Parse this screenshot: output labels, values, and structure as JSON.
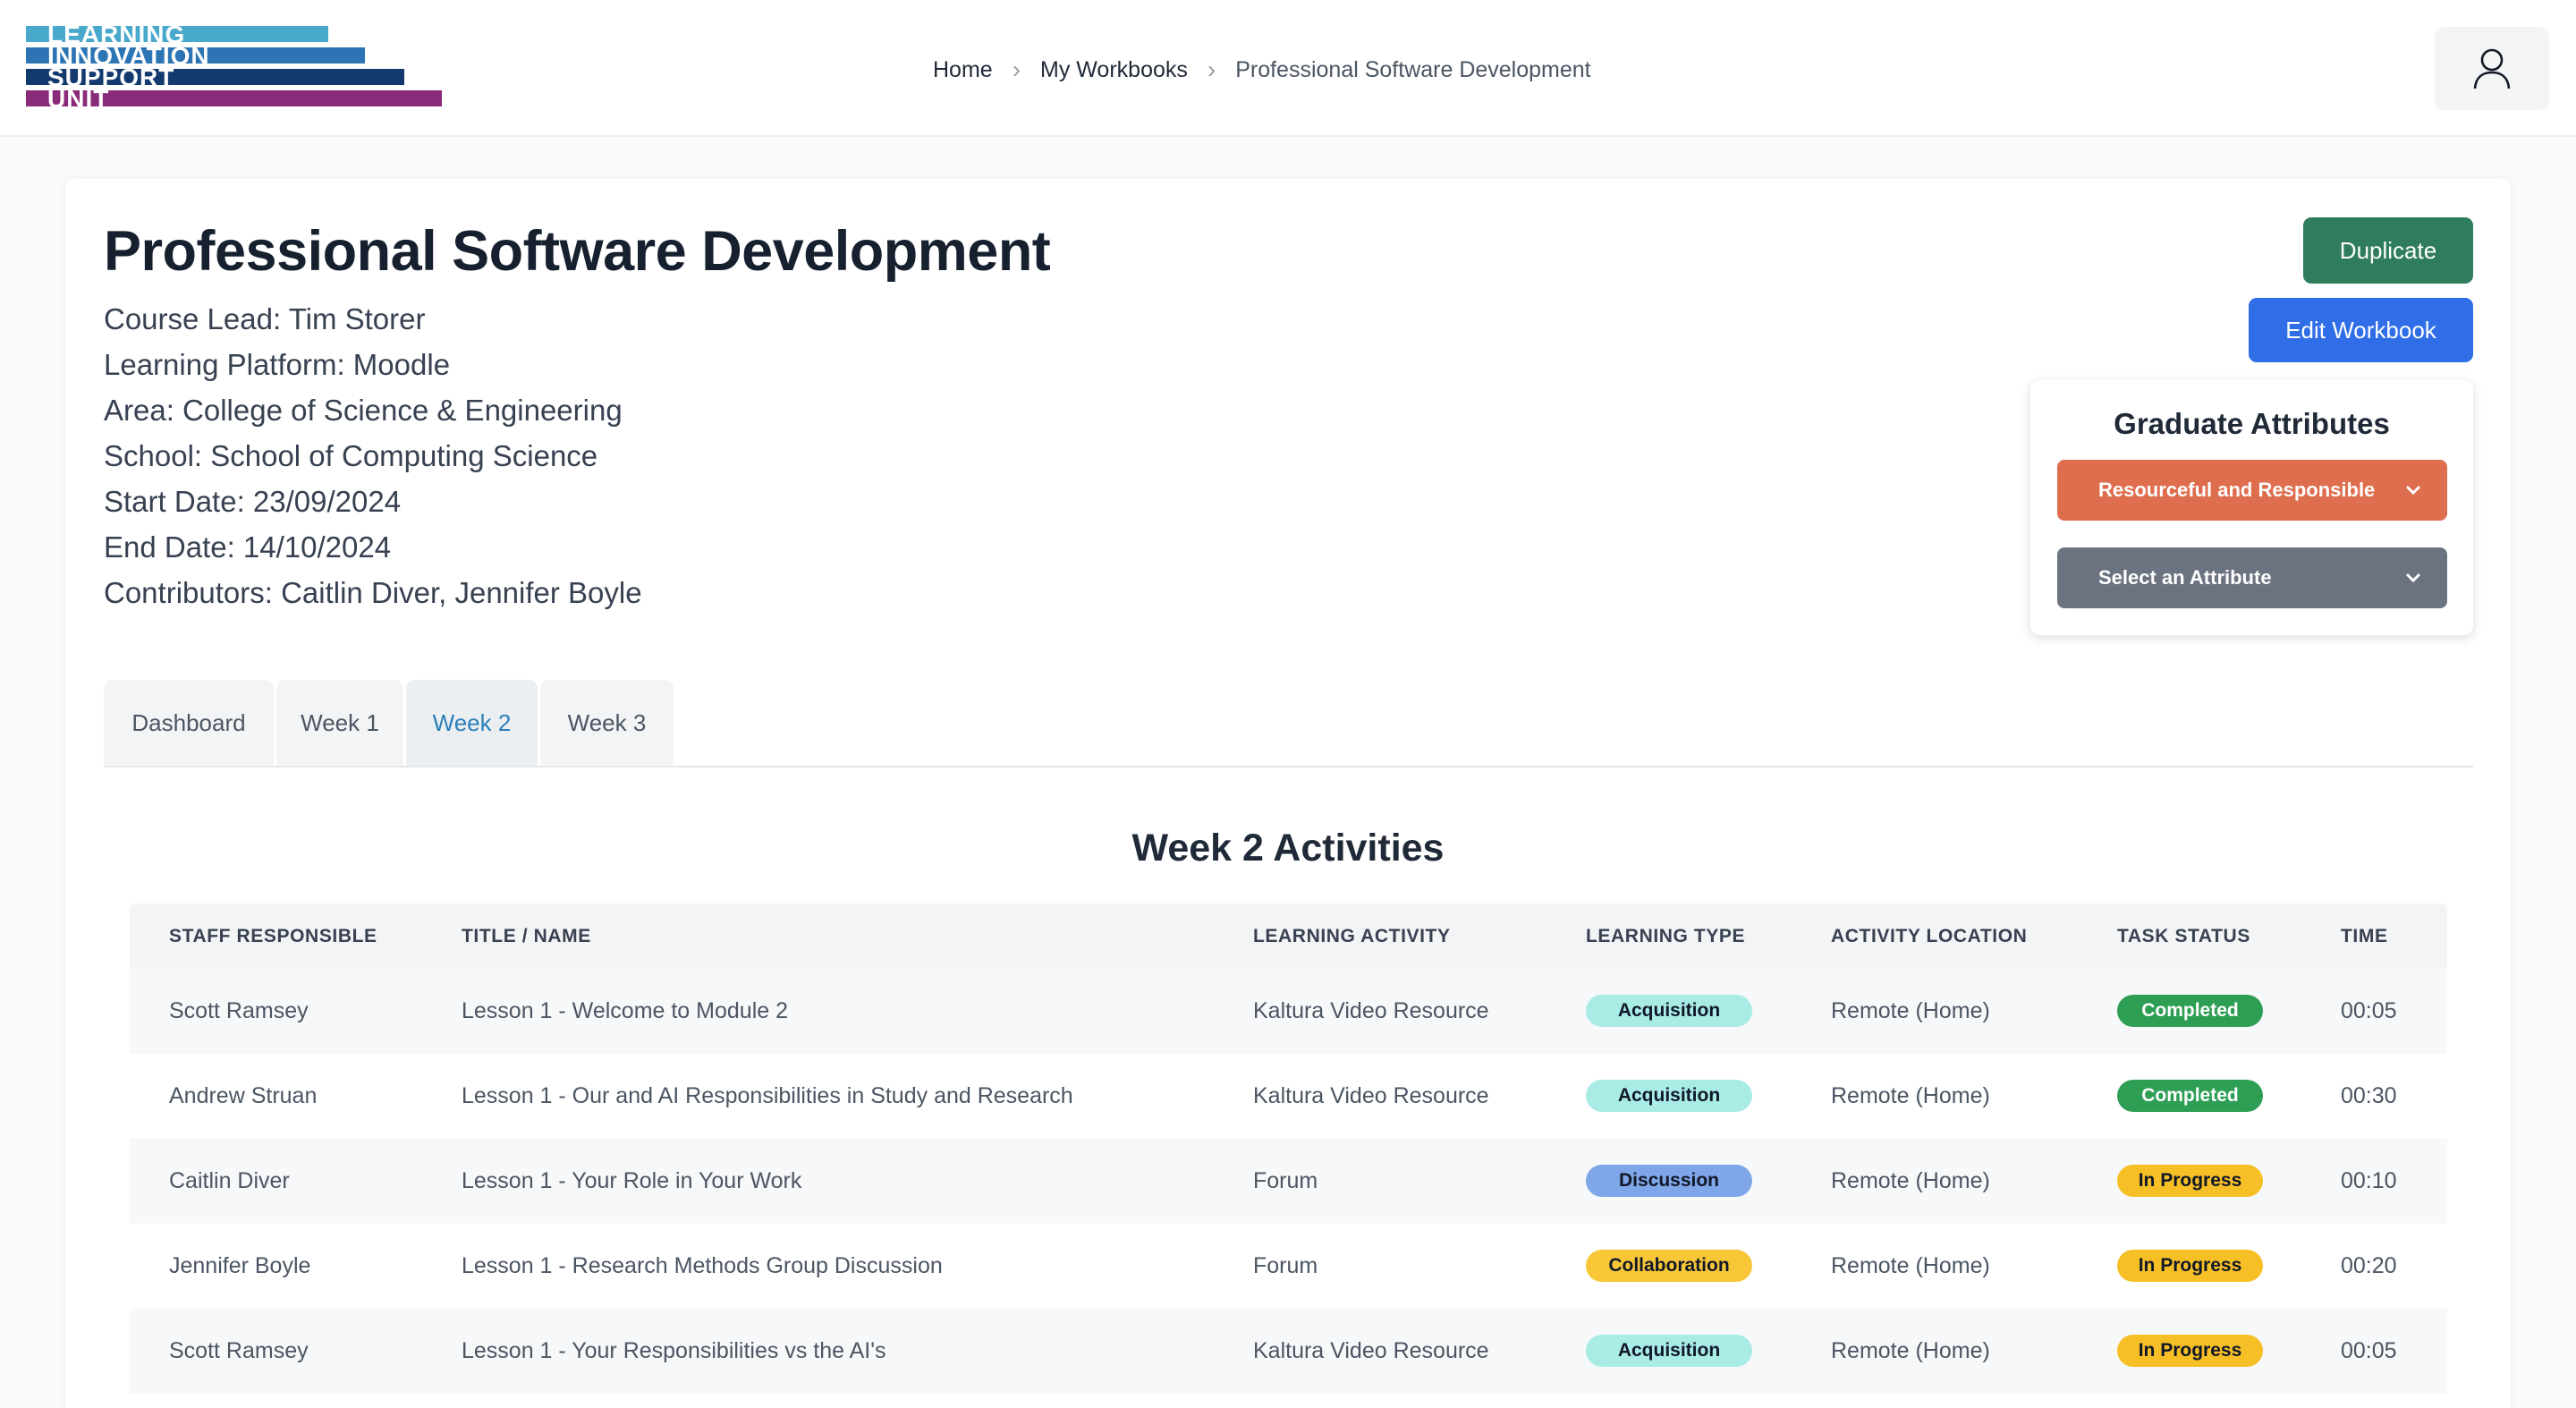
{
  "logo": {
    "lines": [
      "LEARNING",
      "INNOVATION",
      "SUPPORT",
      "UNIT"
    ]
  },
  "breadcrumb": {
    "items": [
      "Home",
      "My Workbooks",
      "Professional Software Development"
    ],
    "separator": "›"
  },
  "user": {
    "icon": "user-icon"
  },
  "workbook": {
    "title": "Professional Software Development",
    "meta": [
      "Course Lead: Tim Storer",
      "Learning Platform: Moodle",
      "Area: College of Science & Engineering",
      "School: School of Computing Science",
      "Start Date: 23/09/2024",
      "End Date: 14/10/2024",
      "Contributors: Caitlin Diver, Jennifer Boyle"
    ]
  },
  "actions": {
    "duplicate": "Duplicate",
    "edit": "Edit Workbook"
  },
  "attributes": {
    "title": "Graduate Attributes",
    "selected": "Resourceful and Responsible",
    "placeholder": "Select an Attribute"
  },
  "tabs": [
    "Dashboard",
    "Week 1",
    "Week 2",
    "Week 3"
  ],
  "active_tab": "Week 2",
  "section_title": "Week 2 Activities",
  "table": {
    "headers": [
      "STAFF RESPONSIBLE",
      "TITLE / NAME",
      "LEARNING ACTIVITY",
      "LEARNING TYPE",
      "ACTIVITY LOCATION",
      "TASK STATUS",
      "TIME"
    ],
    "rows": [
      {
        "staff": "Scott Ramsey",
        "title": "Lesson 1 - Welcome to Module 2",
        "activity": "Kaltura Video Resource",
        "type": "Acquisition",
        "location": "Remote (Home)",
        "status": "Completed",
        "time": "00:05"
      },
      {
        "staff": "Andrew Struan",
        "title": "Lesson 1 - Our and AI Responsibilities in Study and Research",
        "activity": "Kaltura Video Resource",
        "type": "Acquisition",
        "location": "Remote (Home)",
        "status": "Completed",
        "time": "00:30"
      },
      {
        "staff": "Caitlin Diver",
        "title": "Lesson 1 - Your Role in Your Work",
        "activity": "Forum",
        "type": "Discussion",
        "location": "Remote (Home)",
        "status": "In Progress",
        "time": "00:10"
      },
      {
        "staff": "Jennifer Boyle",
        "title": "Lesson 1 - Research Methods Group Discussion",
        "activity": "Forum",
        "type": "Collaboration",
        "location": "Remote (Home)",
        "status": "In Progress",
        "time": "00:20"
      },
      {
        "staff": "Scott Ramsey",
        "title": "Lesson 1 - Your Responsibilities vs the AI's",
        "activity": "Kaltura Video Resource",
        "type": "Acquisition",
        "location": "Remote (Home)",
        "status": "In Progress",
        "time": "00:05"
      }
    ]
  },
  "colors": {
    "duplicate": "#2f7d5c",
    "edit": "#2f6ee6",
    "attribute_selected": "#de6e4e",
    "attribute_empty": "#6b7280",
    "acquisition": "#a9ece6",
    "discussion": "#7ea6e8",
    "collaboration": "#f7c738",
    "completed": "#2e9e55",
    "in_progress": "#f6bf26"
  }
}
